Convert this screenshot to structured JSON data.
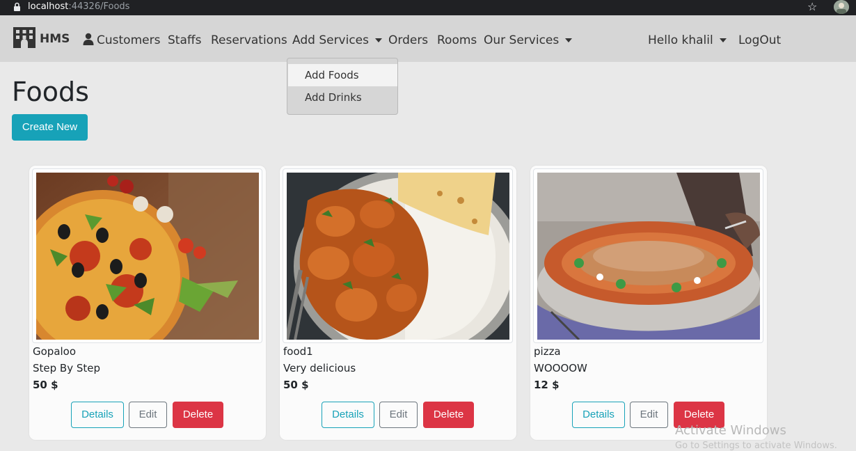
{
  "browser": {
    "url_host": "localhost",
    "url_path": ":44326/Foods"
  },
  "nav": {
    "brand": "HMS",
    "items": [
      "Customers",
      "Staffs",
      "Reservations",
      "Add Services",
      "Orders",
      "Rooms",
      "Our Services"
    ],
    "user": "Hello khalil",
    "logout": "LogOut"
  },
  "dropdown": {
    "items": [
      "Add Foods",
      "Add Drinks"
    ]
  },
  "page": {
    "title": "Foods",
    "create_label": "Create New"
  },
  "cards": [
    {
      "name": "Gopaloo",
      "description": "Step By Step",
      "price": "50 $",
      "image": "pizza-photo"
    },
    {
      "name": "food1",
      "description": "Very delicious",
      "price": "50 $",
      "image": "chicken-curry-rice-photo"
    },
    {
      "name": "pizza",
      "description": "WOOOOW",
      "price": "12 $",
      "image": "street-food-pan-photo"
    }
  ],
  "card_buttons": {
    "details": "Details",
    "edit": "Edit",
    "delete": "Delete"
  },
  "watermark": {
    "line1": "Activate Windows",
    "line2": "Go to Settings to activate Windows."
  },
  "colors": {
    "info": "#17a2b8",
    "danger": "#dc3545",
    "secondary": "#6c757d",
    "navbar": "#d6d6d6"
  }
}
